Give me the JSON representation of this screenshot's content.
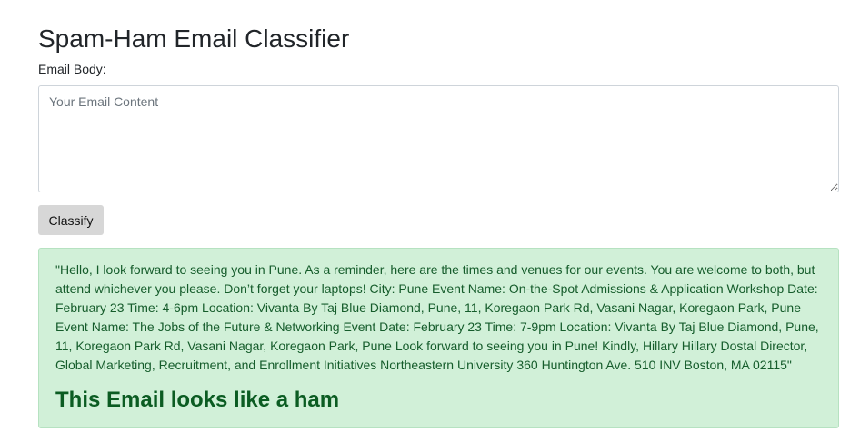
{
  "page": {
    "title": "Spam-Ham Email Classifier"
  },
  "form": {
    "email_label": "Email Body:",
    "email_placeholder": "Your Email Content",
    "email_value": "",
    "classify_label": "Classify"
  },
  "result": {
    "email_text": "\"Hello, I look forward to seeing you in Pune. As a reminder, here are the times and venues for our events. You are welcome to both, but attend whichever you please. Don’t forget your laptops! City: Pune Event Name: On-the-Spot Admissions & Application Workshop Date: February 23 Time: 4-6pm Location: Vivanta By Taj Blue Diamond, Pune, 11, Koregaon Park Rd, Vasani Nagar, Koregaon Park, Pune Event Name: The Jobs of the Future & Networking Event Date: February 23 Time: 7-9pm Location: Vivanta By Taj Blue Diamond, Pune, 11, Koregaon Park Rd, Vasani Nagar, Koregaon Park, Pune Look forward to seeing you in Pune! Kindly, Hillary Hillary Dostal Director, Global Marketing, Recruitment, and Enrollment Initiatives Northeastern University 360 Huntington Ave. 510 INV Boston, MA 02115\"",
    "verdict": "This Email looks like a ham",
    "status_color": "#d1f0d8",
    "verdict_color": "#0b5c22"
  }
}
